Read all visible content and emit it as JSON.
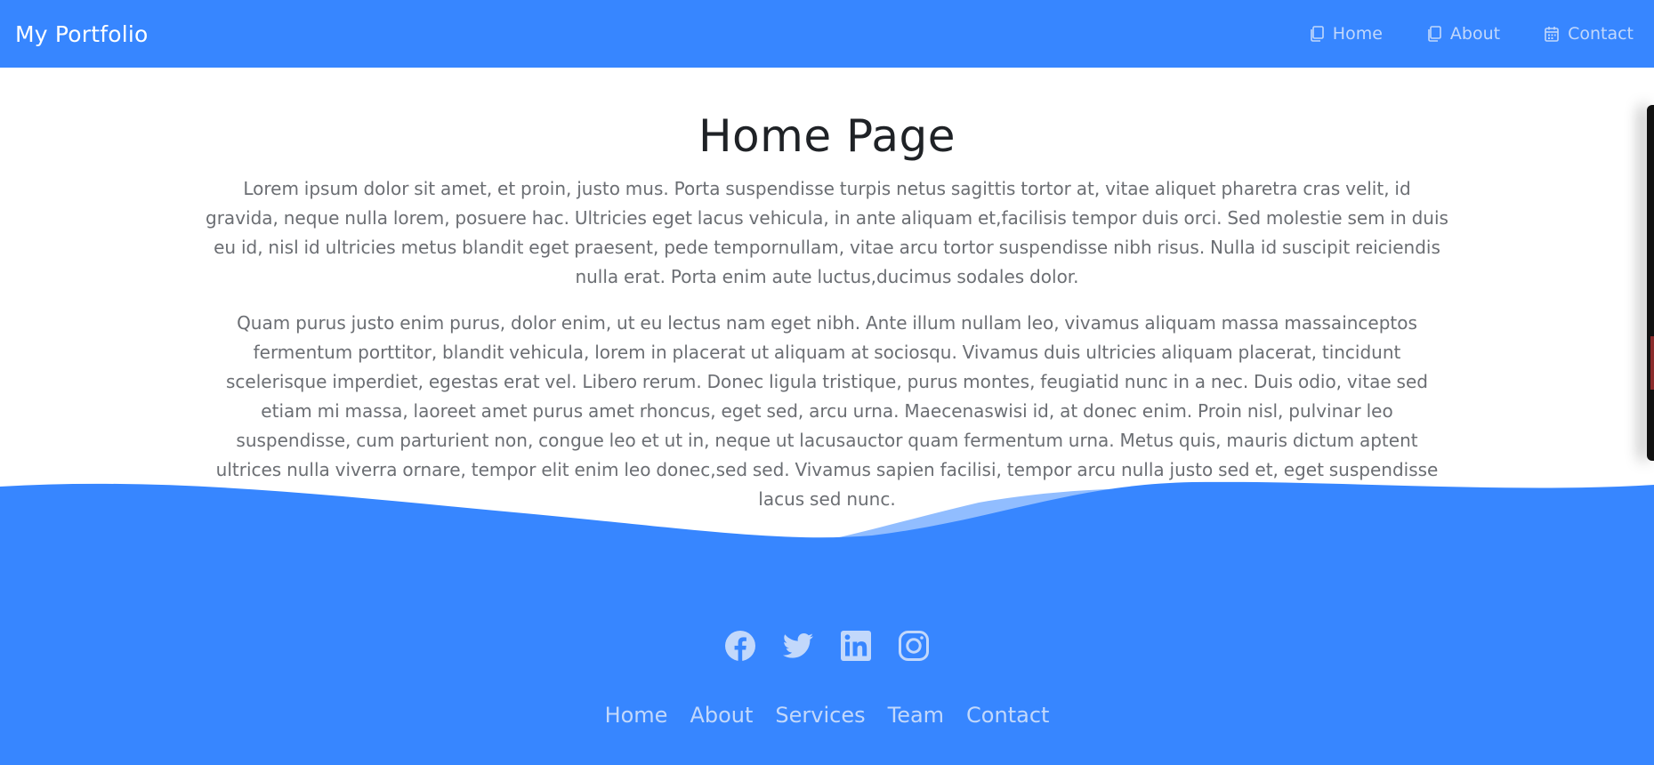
{
  "navbar": {
    "brand": "My Portfolio",
    "links": [
      {
        "label": "Home",
        "icon": "copy-icon"
      },
      {
        "label": "About",
        "icon": "copy-icon"
      },
      {
        "label": "Contact",
        "icon": "calendar-icon"
      }
    ]
  },
  "main": {
    "title": "Home Page",
    "paragraphs": [
      "Lorem ipsum dolor sit amet, et proin, justo mus. Porta suspendisse turpis netus sagittis tortor at, vitae aliquet pharetra cras velit, id gravida, neque nulla lorem, posuere hac. Ultricies eget lacus vehicula, in ante aliquam et,facilisis tempor duis orci. Sed molestie sem in duis eu id, nisl id ultricies metus blandit eget praesent, pede tempornullam, vitae arcu tortor suspendisse nibh risus. Nulla id suscipit reiciendis nulla erat. Porta enim aute luctus,ducimus sodales dolor.",
      "Quam purus justo enim purus, dolor enim, ut eu lectus nam eget nibh. Ante illum nullam leo, vivamus aliquam massa massainceptos fermentum porttitor, blandit vehicula, lorem in placerat ut aliquam at sociosqu. Vivamus duis ultricies aliquam placerat, tincidunt scelerisque imperdiet, egestas erat vel. Libero rerum. Donec ligula tristique, purus montes, feugiatid nunc in a nec. Duis odio, vitae sed etiam mi massa, laoreet amet purus amet rhoncus, eget sed, arcu urna. Maecenaswisi id, at donec enim. Proin nisl, pulvinar leo suspendisse, cum parturient non, congue leo et ut in, neque ut lacusauctor quam fermentum urna. Metus quis, mauris dictum aptent ultrices nulla viverra ornare, tempor elit enim leo donec,sed sed. Vivamus sapien facilisi, tempor arcu nulla justo sed et, eget suspendisse lacus sed nunc."
    ]
  },
  "footer": {
    "social": [
      "facebook-icon",
      "twitter-icon",
      "linkedin-icon",
      "instagram-icon"
    ],
    "links": [
      "Home",
      "About",
      "Services",
      "Team",
      "Contact"
    ]
  },
  "colors": {
    "primary": "#3786ff",
    "nav_link": "#c2d8fb",
    "heading": "#1f2226",
    "body_text": "#6b6e73"
  }
}
